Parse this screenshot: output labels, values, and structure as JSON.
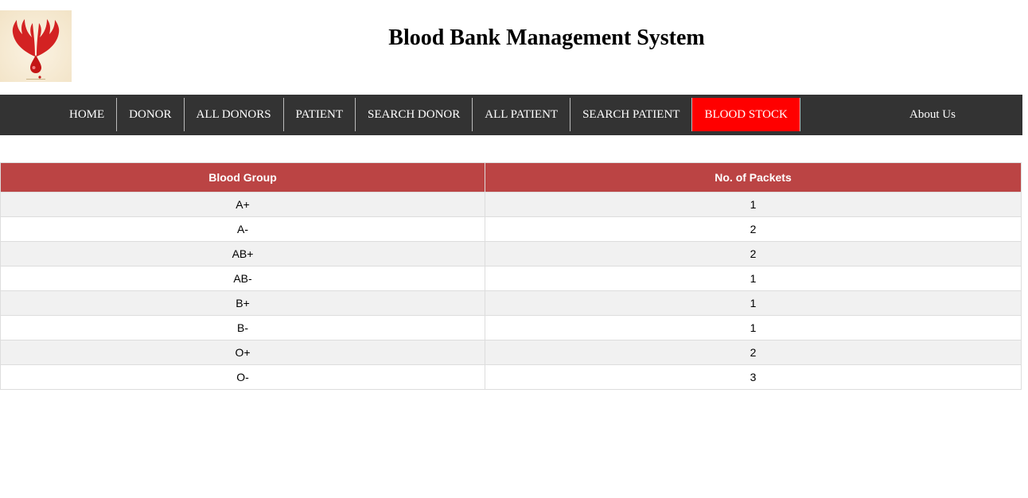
{
  "header": {
    "title": "Blood Bank Management System",
    "logo_icon": "blood-drop-hands-icon"
  },
  "nav": {
    "items": [
      {
        "label": "HOME",
        "active": false
      },
      {
        "label": "DONOR",
        "active": false
      },
      {
        "label": "ALL DONORS",
        "active": false
      },
      {
        "label": "PATIENT",
        "active": false
      },
      {
        "label": "SEARCH DONOR",
        "active": false
      },
      {
        "label": "ALL PATIENT",
        "active": false
      },
      {
        "label": "SEARCH PATIENT",
        "active": false
      },
      {
        "label": "BLOOD STOCK",
        "active": true
      }
    ],
    "about_label": "About Us"
  },
  "table": {
    "headers": [
      "Blood Group",
      "No. of Packets"
    ],
    "rows": [
      {
        "group": "A+",
        "packets": "1"
      },
      {
        "group": "A-",
        "packets": "2"
      },
      {
        "group": "AB+",
        "packets": "2"
      },
      {
        "group": "AB-",
        "packets": "1"
      },
      {
        "group": "B+",
        "packets": "1"
      },
      {
        "group": "B-",
        "packets": "1"
      },
      {
        "group": "O+",
        "packets": "2"
      },
      {
        "group": "O-",
        "packets": "3"
      }
    ]
  },
  "colors": {
    "navbar_bg": "#333333",
    "active_nav_bg": "#ff0000",
    "table_header_bg": "#bb4444",
    "row_alt_bg": "#f1f1f1"
  }
}
